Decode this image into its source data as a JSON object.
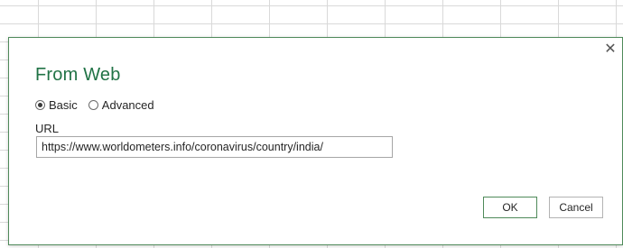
{
  "dialog": {
    "title": "From Web",
    "close_glyph": "✕",
    "close_icon": "close-icon",
    "radio_options": [
      {
        "label": "Basic",
        "selected": true
      },
      {
        "label": "Advanced",
        "selected": false
      }
    ],
    "url_label": "URL",
    "url_value": "https://www.worldometers.info/coronavirus/country/india/",
    "ok_label": "OK",
    "cancel_label": "Cancel"
  },
  "colors": {
    "title": "#217346",
    "dialog_border": "#4f8a5a",
    "gridline": "#d9d9d9"
  }
}
